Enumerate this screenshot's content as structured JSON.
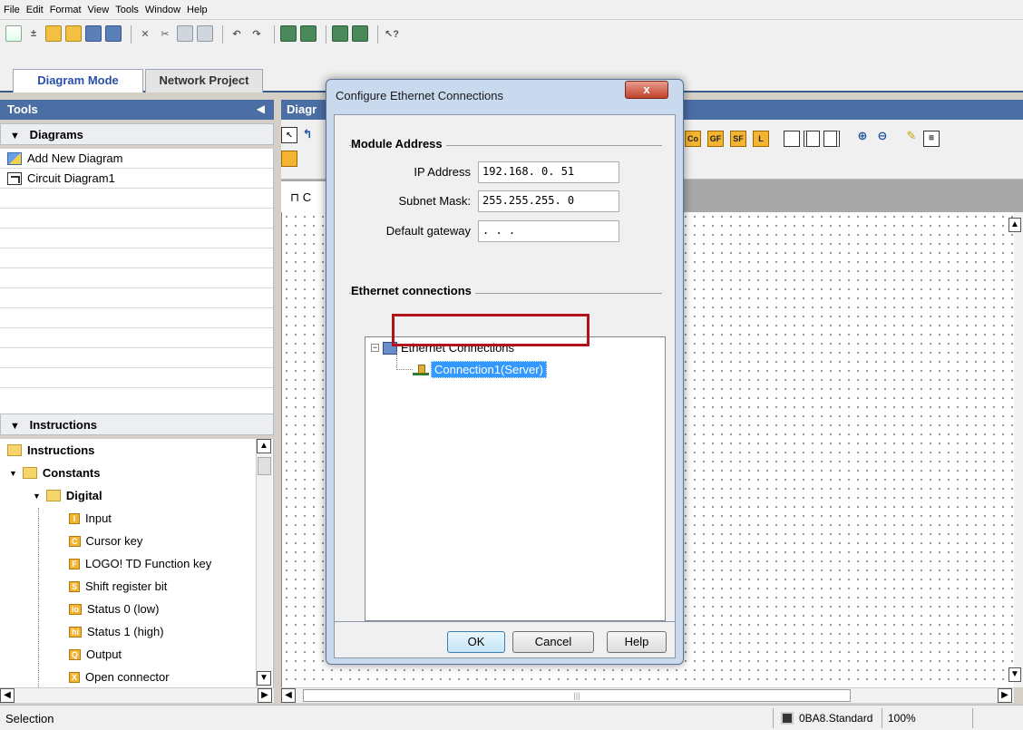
{
  "menu": [
    "File",
    "Edit",
    "Format",
    "View",
    "Tools",
    "Window",
    "Help"
  ],
  "tabs": {
    "active": "Diagram Mode",
    "inactive": "Network Project"
  },
  "tools": {
    "header": "Tools",
    "diagrams_label": "Diagrams",
    "diagram_items": [
      "Add New Diagram",
      "Circuit Diagram1"
    ],
    "instructions_label": "Instructions",
    "tree": {
      "root": "Instructions",
      "constants": "Constants",
      "digital": "Digital",
      "leaves": [
        {
          "badge": "I",
          "label": "Input"
        },
        {
          "badge": "C",
          "label": "Cursor key"
        },
        {
          "badge": "F",
          "label": "LOGO! TD Function key"
        },
        {
          "badge": "S",
          "label": "Shift register bit"
        },
        {
          "badge": "lo",
          "label": "Status 0 (low)"
        },
        {
          "badge": "hi",
          "label": "Status 1 (high)"
        },
        {
          "badge": "Q",
          "label": "Output"
        },
        {
          "badge": "X",
          "label": "Open connector"
        }
      ]
    }
  },
  "diagram": {
    "header": "Diagr",
    "tab_label": "C",
    "toolbar_icons": [
      "Co",
      "GF",
      "SF",
      "L"
    ]
  },
  "dialog": {
    "title": "Configure Ethernet Connections",
    "close": "x",
    "module_address_label": "Module Address",
    "ip_label": "IP Address",
    "ip_value": "192.168.  0. 51",
    "subnet_label": "Subnet Mask:",
    "subnet_value": "255.255.255.  0",
    "gateway_label": "Default gateway",
    "gateway_value": "   .   .   .",
    "connections_label": "Ethernet connections",
    "tree_root": "Ethernet Connections",
    "tree_child": "Connection1(Server)",
    "ok": "OK",
    "cancel": "Cancel",
    "help": "Help"
  },
  "status": {
    "text": "Selection",
    "device": "0BA8.Standard",
    "zoom": "100%"
  },
  "colors": {
    "accent": "#4b6ea5",
    "highlight": "#b0131c",
    "selection": "#3399ff"
  }
}
